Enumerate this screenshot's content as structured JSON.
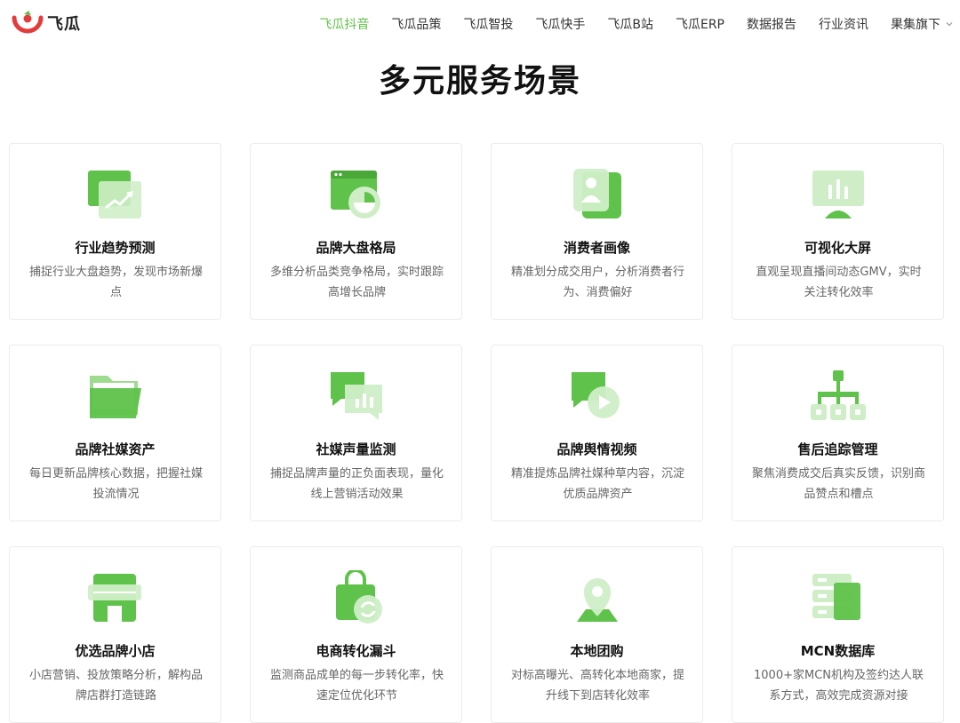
{
  "header": {
    "logo_text": "飞瓜",
    "nav": [
      {
        "label": "飞瓜抖音",
        "active": true
      },
      {
        "label": "飞瓜品策",
        "active": false
      },
      {
        "label": "飞瓜智投",
        "active": false
      },
      {
        "label": "飞瓜快手",
        "active": false
      },
      {
        "label": "飞瓜B站",
        "active": false
      },
      {
        "label": "飞瓜ERP",
        "active": false
      },
      {
        "label": "数据报告",
        "active": false
      },
      {
        "label": "行业资讯",
        "active": false
      }
    ],
    "more_label": "果集旗下"
  },
  "section_title": "多元服务场景",
  "colors": {
    "brand_green": "#5fc24a",
    "logo_red": "#e23c3c"
  },
  "cards": [
    {
      "title": "行业趋势预测",
      "desc": "捕捉行业大盘趋势，发现市场新爆点",
      "icon": "trend-chart-icon"
    },
    {
      "title": "品牌大盘格局",
      "desc": "多维分析品类竞争格局，实时跟踪高增长品牌",
      "icon": "pie-window-icon"
    },
    {
      "title": "消费者画像",
      "desc": "精准划分成交用户，分析消费者行为、消费偏好",
      "icon": "consumer-profile-icon"
    },
    {
      "title": "可视化大屏",
      "desc": "直观呈现直播间动态GMV，实时关注转化效率",
      "icon": "monitor-icon"
    },
    {
      "title": "品牌社媒资产",
      "desc": "每日更新品牌核心数据，把握社媒投流情况",
      "icon": "folder-icon"
    },
    {
      "title": "社媒声量监测",
      "desc": "捕捉品牌声量的正负面表现，量化线上营销活动效果",
      "icon": "chat-bars-icon"
    },
    {
      "title": "品牌舆情视频",
      "desc": "精准提炼品牌社媒种草内容，沉淀优质品牌资产",
      "icon": "video-play-icon"
    },
    {
      "title": "售后追踪管理",
      "desc": "聚焦消费成交后真实反馈，识别商品赞点和槽点",
      "icon": "hierarchy-icon"
    },
    {
      "title": "优选品牌小店",
      "desc": "小店营销、投放策略分析，解构品牌店群打造链路",
      "icon": "store-icon"
    },
    {
      "title": "电商转化漏斗",
      "desc": "监测商品成单的每一步转化率，快速定位优化环节",
      "icon": "shopping-bag-icon"
    },
    {
      "title": "本地团购",
      "desc": "对标高曝光、高转化本地商家，提升线下到店转化效率",
      "icon": "location-pin-icon"
    },
    {
      "title": "MCN数据库",
      "desc": "1000+家MCN机构及签约达人联系方式，高效完成资源对接",
      "icon": "database-icon"
    }
  ]
}
